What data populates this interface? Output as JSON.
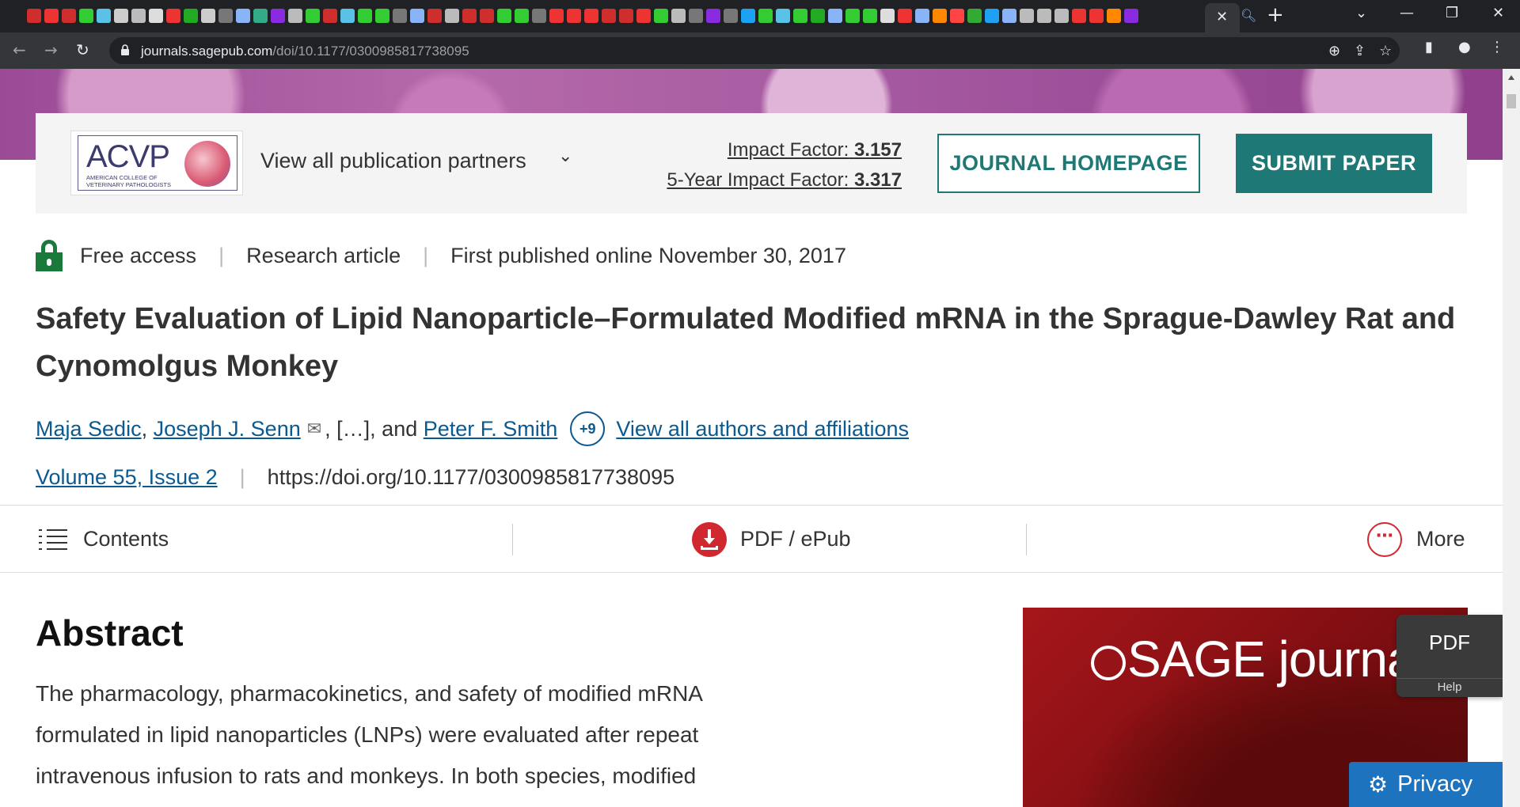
{
  "browser": {
    "tab_favicon_colors": [
      "#d02d2d",
      "#e33",
      "#d02d2d",
      "#3c3",
      "#5bc2e7",
      "#ccc",
      "#bbb",
      "#ddd",
      "#e33",
      "#2a2",
      "#ccc",
      "#777",
      "#8ab4f8",
      "#3a8",
      "#8a2be2",
      "#bbb",
      "#3c3",
      "#d02d2d",
      "#5bc2e7",
      "#3c3",
      "#3c3",
      "#777",
      "#8ab4f8",
      "#d02d2d",
      "#bbb",
      "#d02d2d",
      "#d02d2d",
      "#3c3",
      "#3c3",
      "#777",
      "#e33",
      "#e33",
      "#e33",
      "#d02d2d",
      "#d02d2d",
      "#e33",
      "#3c3",
      "#bbb",
      "#777",
      "#8a2be2",
      "#777",
      "#1da1f2",
      "#3c3",
      "#5bc2e7",
      "#3c3",
      "#2a2",
      "#8ab4f8",
      "#3c3",
      "#3c3",
      "#ddd",
      "#e33",
      "#8ab4f8",
      "#f80",
      "#f44",
      "#3a3",
      "#1da1f2",
      "#8ab4f8",
      "#bbb",
      "#bbb",
      "#bbb",
      "#e33",
      "#e33",
      "#f80",
      "#8a2be2"
    ],
    "active_tab_close": "✕",
    "new_tab": "+",
    "url_host": "journals.sagepub.com",
    "url_path": "/doi/10.1177/0300985817738095"
  },
  "header": {
    "partner_logo_word": "ACVP",
    "partner_logo_sub": "AMERICAN COLLEGE OF VETERINARY PATHOLOGISTS",
    "partners_link": "View all publication partners",
    "impact_factor_label": "Impact Factor:",
    "impact_factor_value": "3.157",
    "five_year_label": "5-Year Impact Factor:",
    "five_year_value": "3.317",
    "journal_homepage_btn": "JOURNAL HOMEPAGE",
    "submit_paper_btn": "SUBMIT PAPER"
  },
  "article": {
    "access": "Free access",
    "type": "Research article",
    "published": "First published online November 30, 2017",
    "title": "Safety Evaluation of Lipid Nanoparticle–Formulated Modified mRNA in the Sprague-Dawley Rat and Cynomolgus Monkey",
    "author1": "Maja Sedic",
    "author2": "Joseph J. Senn",
    "ellipsis": ", […], and",
    "author3": "Peter F. Smith",
    "more_authors": "+9",
    "view_all_authors": "View all authors and affiliations",
    "volume": "Volume 55, Issue 2",
    "doi": "https://doi.org/10.1177/0300985817738095"
  },
  "toolbar": {
    "contents": "Contents",
    "pdf_epub": "PDF / ePub",
    "more": "More"
  },
  "abstract": {
    "heading": "Abstract",
    "text": "The pharmacology, pharmacokinetics, and safety of modified mRNA formulated in lipid nanoparticles (LNPs) were evaluated after repeat intravenous infusion to rats and monkeys. In both species, modified"
  },
  "ad": {
    "brand": "SAGE journals"
  },
  "floating": {
    "pdf": "PDF",
    "help": "Help",
    "privacy": "Privacy"
  }
}
